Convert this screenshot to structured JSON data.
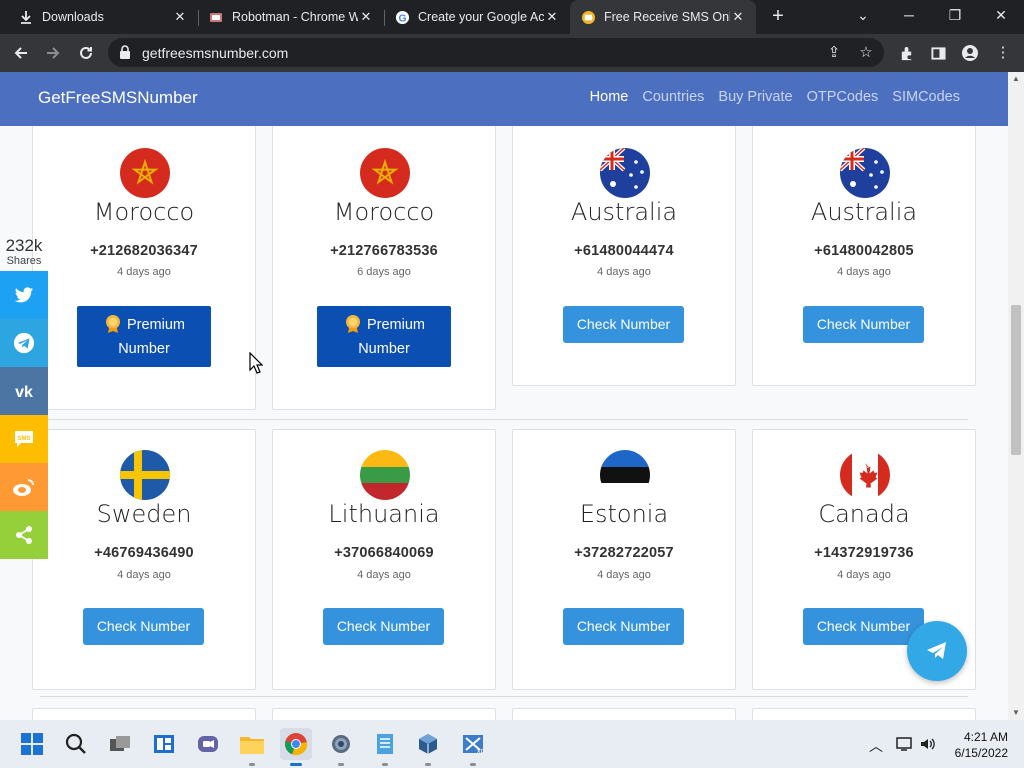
{
  "browser": {
    "tabs": [
      {
        "title": "Downloads",
        "icon": "download-icon"
      },
      {
        "title": "Robotman - Chrome W",
        "icon": "robotman-favicon"
      },
      {
        "title": "Create your Google Ac",
        "icon": "google-icon"
      },
      {
        "title": "Free Receive SMS Onlin",
        "icon": "site-favicon",
        "active": true
      }
    ],
    "url": "getfreesmsnumber.com"
  },
  "site": {
    "brand": "GetFreeSMSNumber",
    "nav": [
      "Home",
      "Countries",
      "Buy Private",
      "OTPCodes",
      "SIMCodes"
    ],
    "active_nav": "Home"
  },
  "share": {
    "count": "232k",
    "label": "Shares",
    "buttons": [
      {
        "name": "twitter",
        "color": "#1da1f2"
      },
      {
        "name": "telegram",
        "color": "#2ca5e0"
      },
      {
        "name": "vk",
        "color": "#4c75a3"
      },
      {
        "name": "sms",
        "color": "#ffbd00"
      },
      {
        "name": "weibo",
        "color": "#ff9933"
      },
      {
        "name": "share",
        "color": "#95d03a"
      }
    ]
  },
  "cards": [
    {
      "country": "Morocco",
      "number": "+212682036347",
      "ago": "4 days ago",
      "button": "Premium Number",
      "premium": true,
      "flag": "morocco"
    },
    {
      "country": "Morocco",
      "number": "+212766783536",
      "ago": "6 days ago",
      "button": "Premium Number",
      "premium": true,
      "flag": "morocco"
    },
    {
      "country": "Australia",
      "number": "+61480044474",
      "ago": "4 days ago",
      "button": "Check Number",
      "premium": false,
      "flag": "australia"
    },
    {
      "country": "Australia",
      "number": "+61480042805",
      "ago": "4 days ago",
      "button": "Check Number",
      "premium": false,
      "flag": "australia"
    },
    {
      "country": "Sweden",
      "number": "+46769436490",
      "ago": "4 days ago",
      "button": "Check Number",
      "premium": false,
      "flag": "sweden"
    },
    {
      "country": "Lithuania",
      "number": "+37066840069",
      "ago": "4 days ago",
      "button": "Check Number",
      "premium": false,
      "flag": "lithuania"
    },
    {
      "country": "Estonia",
      "number": "+37282722057",
      "ago": "4 days ago",
      "button": "Check Number",
      "premium": false,
      "flag": "estonia"
    },
    {
      "country": "Canada",
      "number": "+14372919736",
      "ago": "4 days ago",
      "button": "Check Number",
      "premium": false,
      "flag": "canada"
    }
  ],
  "premium_button": {
    "line1": "Premium",
    "line2": "Number"
  },
  "taskbar": {
    "time": "4:21 AM",
    "date": "6/15/2022"
  }
}
